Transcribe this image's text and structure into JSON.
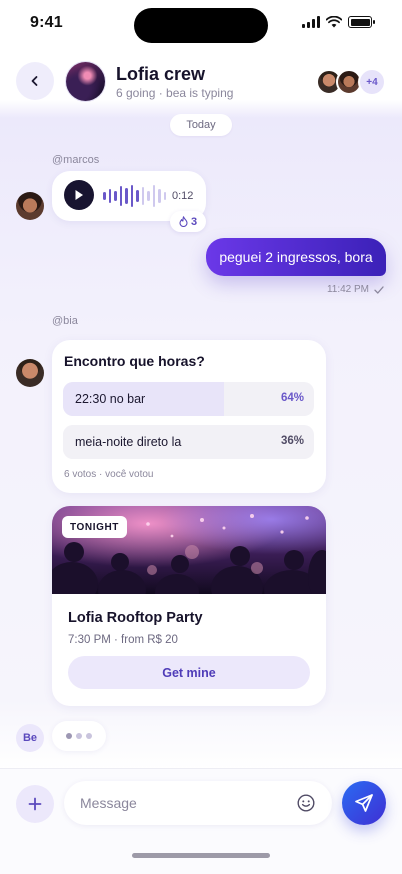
{
  "status_bar": {
    "time": "9:41"
  },
  "header": {
    "title": "Lofia crew",
    "subtitle": "6 going · bea is typing",
    "extra_members": "+4"
  },
  "date_divider": "Today",
  "messages": {
    "voice": {
      "sender": "@marcos",
      "duration": "0:12",
      "reaction_count": "3"
    },
    "outgoing": {
      "text": "peguei 2 ingressos, bora",
      "time": "11:42 PM"
    },
    "poll": {
      "sender": "@bia",
      "question": "Encontro que horas?",
      "options": [
        {
          "label": "22:30 no bar",
          "percent": "64%",
          "value": 64,
          "leading": true
        },
        {
          "label": "meia-noite direto la",
          "percent": "36%",
          "value": 36,
          "leading": false
        }
      ],
      "footer": "6 votos · você votou"
    },
    "event": {
      "tag": "TONIGHT",
      "title": "Lofia Rooftop Party",
      "meta": "7:30 PM · from R$ 20",
      "cta": "Get mine"
    },
    "typing": {
      "initials": "Be"
    }
  },
  "composer": {
    "placeholder": "Message"
  },
  "colors": {
    "accent": "#6a58c9",
    "send_gradient_start": "#2a6bf2",
    "outgoing_bubble_start": "#6b38e8",
    "outgoing_bubble_end": "#3b21b8"
  }
}
